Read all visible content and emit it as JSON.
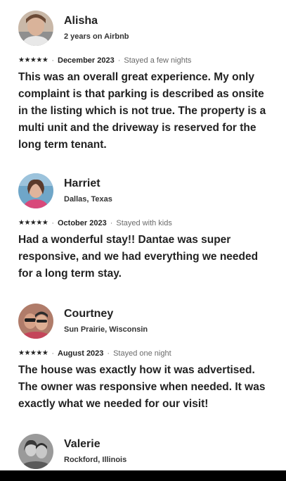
{
  "reviews": [
    {
      "name": "Alisha",
      "subtitle": "2 years on Airbnb",
      "rating": "★★★★★",
      "date": "December 2023",
      "stay": "Stayed a few nights",
      "text": "This was an overall great experience.  My only complaint is that parking is described as onsite in the listing which is not true. The property is a multi unit and the driveway is reserved for the long term tenant."
    },
    {
      "name": "Harriet",
      "subtitle": "Dallas, Texas",
      "rating": "★★★★★",
      "date": "October 2023",
      "stay": "Stayed with kids",
      "text": "Had a wonderful stay!! Dantae was super responsive, and we had everything we needed for a long term stay."
    },
    {
      "name": "Courtney",
      "subtitle": "Sun Prairie, Wisconsin",
      "rating": "★★★★★",
      "date": "August 2023",
      "stay": "Stayed one night",
      "text": "The house was exactly how it was advertised. The owner was responsive when needed.  It was exactly what we needed for our visit!"
    },
    {
      "name": "Valerie",
      "subtitle": "Rockford, Illinois"
    }
  ],
  "separator": "·",
  "colors": {
    "text": "#222222",
    "muted": "#6a6a6a",
    "bottom_bar": "#000000"
  }
}
